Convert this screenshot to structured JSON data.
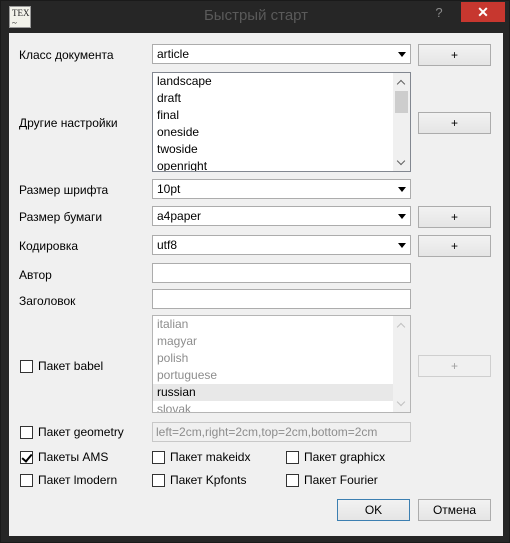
{
  "window": {
    "title": "Быстрый старт",
    "icon_text": [
      "TEX",
      "~"
    ],
    "help_label": "?",
    "close_label": "✕"
  },
  "doc_class": {
    "label": "Класс документа",
    "value": "article",
    "add_label": "+"
  },
  "other_options": {
    "label": "Другие настройки",
    "items": [
      "landscape",
      "draft",
      "final",
      "oneside",
      "twoside",
      "openright"
    ],
    "add_label": "+"
  },
  "font_size": {
    "label": "Размер шрифта",
    "value": "10pt"
  },
  "paper_size": {
    "label": "Размер бумаги",
    "value": "a4paper",
    "add_label": "+"
  },
  "encoding": {
    "label": "Кодировка",
    "value": "utf8",
    "add_label": "+"
  },
  "author": {
    "label": "Автор",
    "value": ""
  },
  "title_field": {
    "label": "Заголовок",
    "value": ""
  },
  "babel": {
    "label": "Пакет babel",
    "checked": false,
    "languages": [
      "italian",
      "magyar",
      "polish",
      "portuguese",
      "russian",
      "slovak"
    ],
    "selected": "russian",
    "add_label": "+"
  },
  "geometry": {
    "label": "Пакет geometry",
    "checked": false,
    "value": "left=2cm,right=2cm,top=2cm,bottom=2cm"
  },
  "packages": {
    "ams": {
      "label": "Пакеты AMS",
      "checked": true
    },
    "makeidx": {
      "label": "Пакет makeidx",
      "checked": false
    },
    "graphicx": {
      "label": "Пакет graphicx",
      "checked": false
    },
    "lmodern": {
      "label": "Пакет lmodern",
      "checked": false
    },
    "kpfonts": {
      "label": "Пакет Kpfonts",
      "checked": false
    },
    "fourier": {
      "label": "Пакет Fourier",
      "checked": false
    }
  },
  "buttons": {
    "ok_label": "OK",
    "cancel_label": "Отмена"
  }
}
